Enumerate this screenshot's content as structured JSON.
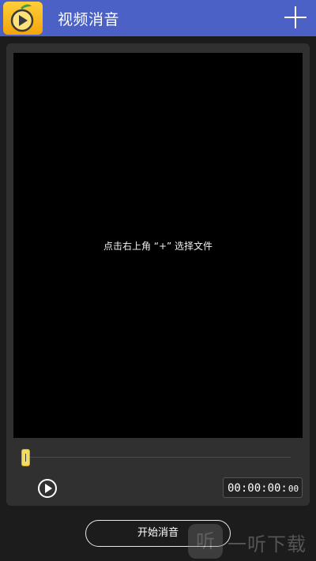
{
  "app_bar": {
    "title": "视频消音",
    "logo_icon": "mango-play-logo-icon",
    "add_icon": "plus-icon"
  },
  "preview": {
    "hint": "点击右上角 “+” 选择文件"
  },
  "player": {
    "play_icon": "play-icon",
    "progress": 0,
    "time_main": "00:00:00:",
    "time_frames": "00"
  },
  "actions": {
    "start_label": "开始消音"
  },
  "watermark": {
    "icon_glyph": "听",
    "text": "一听下载"
  },
  "colors": {
    "app_bar": "#4b61c6",
    "background": "#1c1c1c",
    "card": "#303030",
    "handle": "#f3dc66"
  }
}
